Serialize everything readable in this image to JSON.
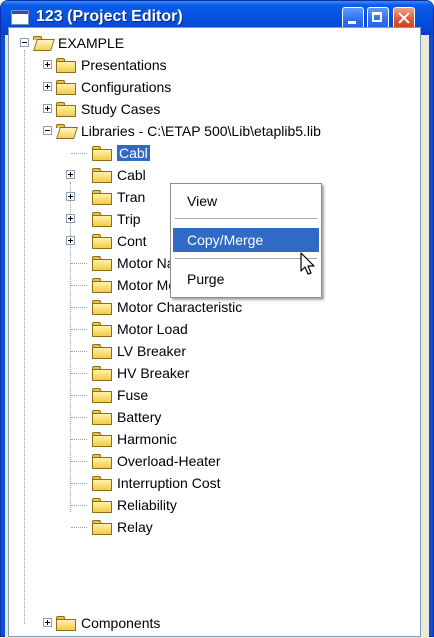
{
  "window": {
    "title": "123 (Project Editor)",
    "icon": "app-window-icon",
    "buttons": [
      "minimize",
      "maximize",
      "close"
    ]
  },
  "tree": {
    "root_label": "EXAMPLE",
    "items": [
      {
        "label": "Presentations",
        "expandable": true
      },
      {
        "label": "Configurations",
        "expandable": true
      },
      {
        "label": "Study Cases",
        "expandable": true
      },
      {
        "label": "Libraries - C:\\ETAP 500\\Lib\\etaplib5.lib",
        "expandable": true,
        "expanded": true
      },
      {
        "label": "Cabl",
        "selected": true
      },
      {
        "label": "Cabl",
        "expandable": true
      },
      {
        "label": "Tran",
        "expandable": true
      },
      {
        "label": "Trip",
        "expandable": true
      },
      {
        "label": "Cont",
        "expandable": true
      },
      {
        "label": "Motor Nameplate"
      },
      {
        "label": "Motor Model"
      },
      {
        "label": "Motor Characteristic"
      },
      {
        "label": "Motor Load"
      },
      {
        "label": "LV Breaker"
      },
      {
        "label": "HV Breaker"
      },
      {
        "label": "Fuse"
      },
      {
        "label": "Battery"
      },
      {
        "label": "Harmonic"
      },
      {
        "label": "Overload-Heater"
      },
      {
        "label": "Interruption Cost"
      },
      {
        "label": "Reliability"
      },
      {
        "label": "Relay"
      },
      {
        "label": "Components",
        "expandable": true
      }
    ]
  },
  "context_menu": {
    "items": [
      "View",
      "Copy/Merge",
      "Purge"
    ],
    "highlighted": "Copy/Merge"
  },
  "colors": {
    "titlebar": "#0553e3",
    "selection": "#316ac5"
  }
}
